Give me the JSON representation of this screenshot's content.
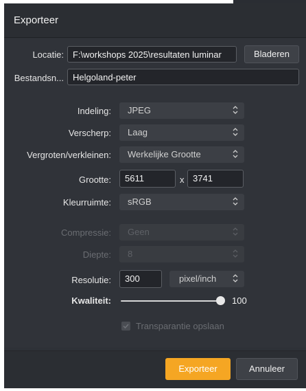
{
  "dialog": {
    "title": "Exporteer"
  },
  "location": {
    "label": "Locatie:",
    "value": "F:\\workshops 2025\\resultaten luminar",
    "browse_label": "Bladeren"
  },
  "filename": {
    "label": "Bestandsn...",
    "value": "Helgoland-peter"
  },
  "format": {
    "label": "Indeling:",
    "value": "JPEG"
  },
  "sharpen": {
    "label": "Verscherp:",
    "value": "Laag"
  },
  "resize": {
    "label": "Vergroten/verkleinen:",
    "value": "Werkelijke Grootte"
  },
  "size": {
    "label": "Grootte:",
    "width": "5611",
    "separator": "x",
    "height": "3741"
  },
  "colorspace": {
    "label": "Kleurruimte:",
    "value": "sRGB"
  },
  "compression": {
    "label": "Compressie:",
    "value": "Geen",
    "enabled": false
  },
  "depth": {
    "label": "Diepte:",
    "value": "8",
    "enabled": false
  },
  "resolution": {
    "label": "Resolutie:",
    "value": "300",
    "unit": "pixel/inch"
  },
  "quality": {
    "label": "Kwaliteit:",
    "value": "100",
    "fraction": 1.0
  },
  "transparency": {
    "label": "Transparantie opslaan",
    "checked": true,
    "enabled": false
  },
  "actions": {
    "export_label": "Exporteer",
    "cancel_label": "Annuleer"
  },
  "colors": {
    "accent": "#f5a623",
    "background": "#303339",
    "field_bg": "#23252a"
  },
  "icons": {
    "select_chevron": "chevron-updown-icon",
    "checkbox_check": "check-icon"
  }
}
